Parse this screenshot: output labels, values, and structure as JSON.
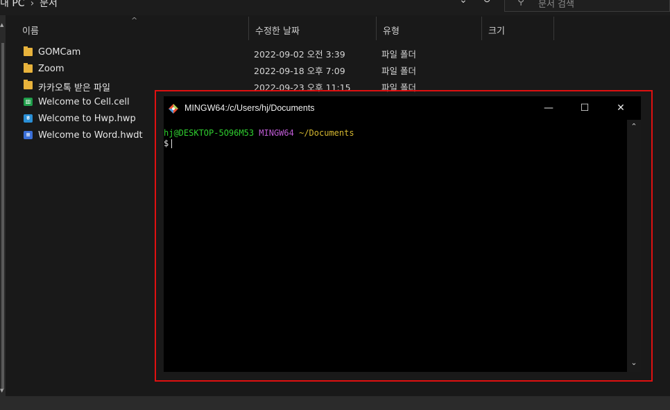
{
  "explorer": {
    "breadcrumb": [
      "내 PC",
      "문서"
    ],
    "breadcrumb_sep": "›",
    "search_placeholder": "문서 검색",
    "columns": {
      "name": "이름",
      "date": "수정한 날짜",
      "type": "유형",
      "size": "크기"
    },
    "files": [
      {
        "name": "GOMCam",
        "date": "2022-09-02 오전 3:39",
        "type": "파일 폴더",
        "icon": "folder-icon"
      },
      {
        "name": "Zoom",
        "date": "2022-09-18 오후 7:09",
        "type": "파일 폴더",
        "icon": "folder-icon"
      },
      {
        "name": "카카오톡 받은 파일",
        "date": "2022-09-23 오후 11:15",
        "type": "파일 폴더",
        "icon": "folder-icon"
      },
      {
        "name": "Welcome to Cell.cell",
        "date": "",
        "type": "",
        "icon": "cell-doc-icon"
      },
      {
        "name": "Welcome to Hwp.hwp",
        "date": "",
        "type": "",
        "icon": "hwp-doc-icon"
      },
      {
        "name": "Welcome to Word.hwdt",
        "date": "",
        "type": "",
        "icon": "word-doc-icon"
      }
    ]
  },
  "terminal": {
    "title": "MINGW64:/c/Users/hj/Documents",
    "prompt_user": "hj@DESKTOP-5O96M53",
    "prompt_host": "MINGW64",
    "prompt_path": "~/Documents",
    "prompt_symbol": "$",
    "buttons": {
      "minimize": "—",
      "maximize": "☐",
      "close": "✕"
    }
  },
  "colors": {
    "highlight_border": "#e01010",
    "prompt_user": "#2fd02f",
    "prompt_host": "#c05cd6",
    "prompt_path": "#d6b830",
    "folder": "#e8b33c"
  }
}
